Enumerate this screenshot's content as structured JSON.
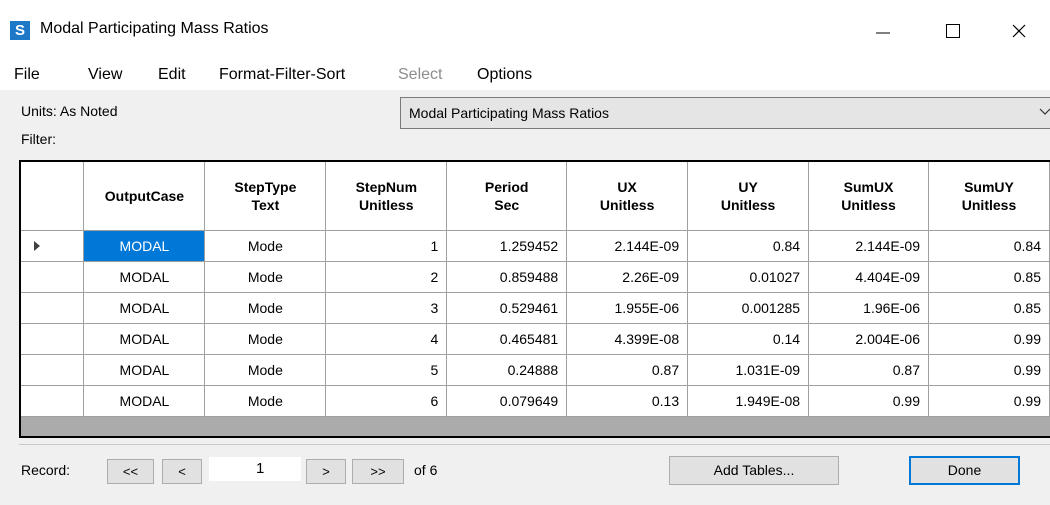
{
  "window": {
    "app_icon_letter": "S",
    "title": "Modal Participating Mass Ratios",
    "minimize_icon": "minimize-icon",
    "maximize_icon": "maximize-icon",
    "close_icon": "close-icon"
  },
  "menu": [
    "File",
    "View",
    "Edit",
    "Format-Filter-Sort",
    "Select",
    "Options"
  ],
  "disabled_menu": "Select",
  "info": {
    "units": "Units: As Noted",
    "filter": "Filter:",
    "table_selected": "Modal Participating Mass Ratios"
  },
  "grid": {
    "columns": [
      "OutputCase",
      "StepType\nText",
      "StepNum\nUnitless",
      "Period\nSec",
      "UX\nUnitless",
      "UY\nUnitless",
      "SumUX\nUnitless",
      "SumUY\nUnitless"
    ],
    "rows": [
      [
        "MODAL",
        "Mode",
        "1",
        "1.259452",
        "2.144E-09",
        "0.84",
        "2.144E-09",
        "0.84"
      ],
      [
        "MODAL",
        "Mode",
        "2",
        "0.859488",
        "2.26E-09",
        "0.01027",
        "4.404E-09",
        "0.85"
      ],
      [
        "MODAL",
        "Mode",
        "3",
        "0.529461",
        "1.955E-06",
        "0.001285",
        "1.96E-06",
        "0.85"
      ],
      [
        "MODAL",
        "Mode",
        "4",
        "0.465481",
        "4.399E-08",
        "0.14",
        "2.004E-06",
        "0.99"
      ],
      [
        "MODAL",
        "Mode",
        "5",
        "0.24888",
        "0.87",
        "1.031E-09",
        "0.87",
        "0.99"
      ],
      [
        "MODAL",
        "Mode",
        "6",
        "0.079649",
        "0.13",
        "1.949E-08",
        "0.99",
        "0.99"
      ]
    ],
    "selected_row": 0
  },
  "record": {
    "label": "Record:",
    "first": "<<",
    "prev": "<",
    "value": "1",
    "next": ">",
    "last": ">>",
    "of": "of 6"
  },
  "buttons": {
    "add_tables": "Add Tables...",
    "done": "Done"
  },
  "colors": {
    "accent": "#0078d7",
    "app_icon": "#1e78c8"
  }
}
